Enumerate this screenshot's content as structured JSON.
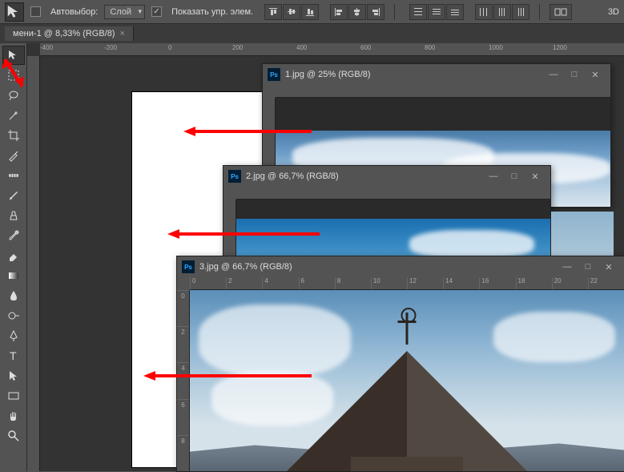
{
  "options_bar": {
    "autoselect_label": "Автовыбор:",
    "layer_dropdown": "Слой",
    "show_controls_label": "Показать упр. элем."
  },
  "main_tab": {
    "title": "мени-1 @ 8,33% (RGB/8)",
    "close": "×"
  },
  "windows": [
    {
      "title": "1.jpg @ 25% (RGB/8)"
    },
    {
      "title": "2.jpg @ 66,7% (RGB/8)"
    },
    {
      "title": "3.jpg @ 66,7% (RGB/8)"
    }
  ],
  "ruler_h_main": [
    "-400",
    "-200",
    "0",
    "200",
    "400",
    "600",
    "800",
    "1000",
    "1200"
  ],
  "ruler3_h": [
    "0",
    "2",
    "4",
    "6",
    "8",
    "10",
    "12",
    "14",
    "16",
    "18",
    "20",
    "22"
  ],
  "ruler3_v": [
    "0",
    "2",
    "4",
    "6",
    "8"
  ],
  "win_buttons": {
    "min": "—",
    "max": "□",
    "close": "✕"
  },
  "right_label": "3D"
}
